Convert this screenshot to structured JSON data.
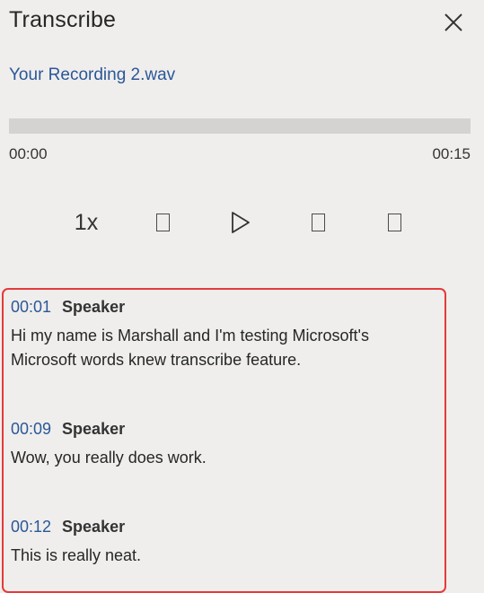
{
  "panel": {
    "title": "Transcribe",
    "close_icon": "close-icon"
  },
  "recording": {
    "file_name": "Your Recording 2.wav"
  },
  "player": {
    "progress": 0.0,
    "time_start": "00:00",
    "time_end": "00:15",
    "speed_label": "1x",
    "icons": [
      "rewind-icon",
      "play-icon",
      "forward-icon",
      "settings-icon"
    ]
  },
  "transcript": {
    "highlight_color": "#e53a3a",
    "link_color": "#2b5797",
    "entries": [
      {
        "timestamp": "00:01",
        "speaker": "Speaker",
        "text": "Hi my name is Marshall and I'm testing Microsoft's Microsoft words knew transcribe feature."
      },
      {
        "timestamp": "00:09",
        "speaker": "Speaker",
        "text": "Wow, you really does work."
      },
      {
        "timestamp": "00:12",
        "speaker": "Speaker",
        "text": "This is really neat."
      }
    ]
  }
}
